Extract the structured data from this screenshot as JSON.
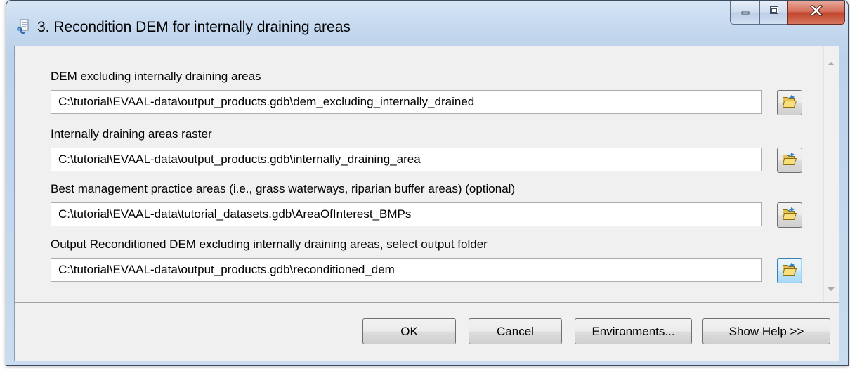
{
  "window": {
    "title": "3. Recondition DEM for internally draining areas",
    "title_icon": "script-tool-icon",
    "controls": [
      "minimize-icon",
      "maximize-icon",
      "close-icon"
    ]
  },
  "parameters": [
    {
      "label": "DEM excluding internally draining areas",
      "value": "C:\\tutorial\\EVAAL-data\\output_products.gdb\\dem_excluding_internally_drained",
      "browse_icon": "open-folder-icon"
    },
    {
      "label": "Internally draining areas raster",
      "value": "C:\\tutorial\\EVAAL-data\\output_products.gdb\\internally_draining_area",
      "browse_icon": "open-folder-icon"
    },
    {
      "label": "Best management practice areas (i.e., grass waterways, riparian buffer areas) (optional)",
      "value": "C:\\tutorial\\EVAAL-data\\tutorial_datasets.gdb\\AreaOfInterest_BMPs",
      "browse_icon": "open-folder-icon"
    },
    {
      "label": "Output Reconditioned DEM excluding internally draining areas, select output folder",
      "value": "C:\\tutorial\\EVAAL-data\\output_products.gdb\\reconditioned_dem",
      "browse_icon": "open-folder-icon"
    }
  ],
  "buttons": {
    "ok": "OK",
    "cancel": "Cancel",
    "environments": "Environments...",
    "show_help": "Show Help >>"
  },
  "colors": {
    "frame": "#c4d8ee",
    "client": "#f0f0f0",
    "close_button": "#c2472e",
    "focus_accent": "#3c7fb1"
  }
}
